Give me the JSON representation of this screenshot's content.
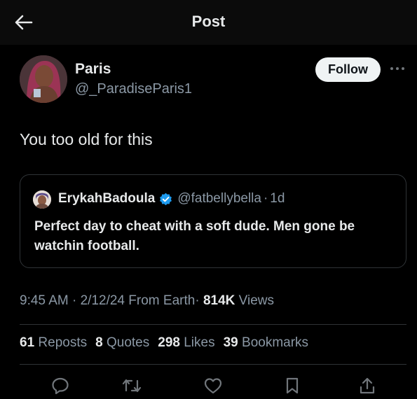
{
  "header": {
    "title": "Post",
    "back_icon": "arrow-left-icon"
  },
  "author": {
    "display_name": "Paris",
    "handle": "@_ParadiseParis1",
    "follow_label": "Follow",
    "more_icon": "more-options-icon"
  },
  "post": {
    "text": "You too old for this"
  },
  "quote": {
    "display_name": "ErykahBadoula",
    "verified_icon": "verified-badge-icon",
    "handle": "@fatbellybella",
    "separator": "·",
    "time": "1d",
    "text": "Perfect day to cheat with a soft dude. Men gone be watchin football."
  },
  "meta": {
    "time": "9:45 AM",
    "dot1": "·",
    "date": "2/12/24",
    "source": "From Earth",
    "dot2": "·",
    "views_count": "814K",
    "views_label": "Views"
  },
  "stats": [
    {
      "count": "61",
      "label": "Reposts"
    },
    {
      "count": "8",
      "label": "Quotes"
    },
    {
      "count": "298",
      "label": "Likes"
    },
    {
      "count": "39",
      "label": "Bookmarks"
    }
  ],
  "actions": [
    "reply-icon",
    "repost-icon",
    "like-icon",
    "bookmark-icon",
    "share-icon"
  ],
  "colors": {
    "background": "#000000",
    "primary_text": "#e7e9ea",
    "secondary_text": "#8b98a5",
    "border": "#2f3336",
    "verified": "#1d9bf0",
    "follow_bg": "#eff3f4"
  }
}
